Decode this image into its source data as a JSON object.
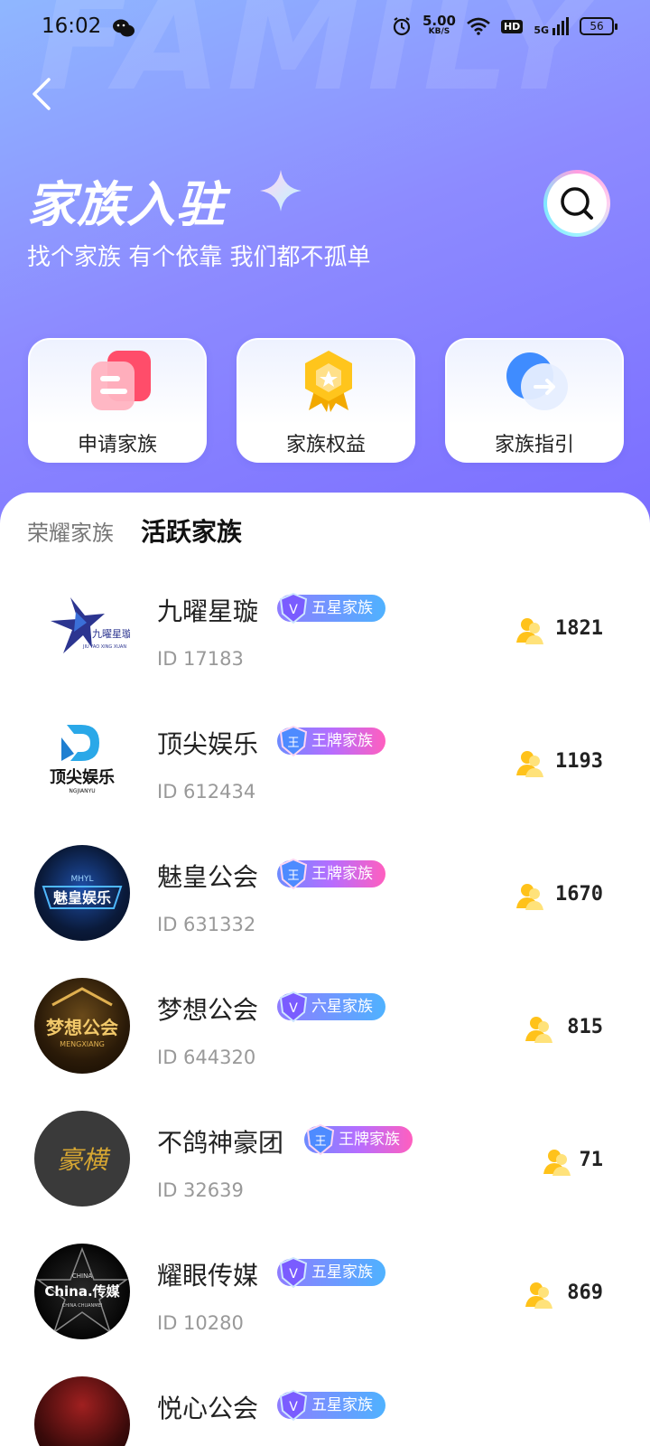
{
  "status_bar": {
    "time": "16:02",
    "net_speed": "5.00",
    "net_unit": "KB/S",
    "hd": "HD",
    "signal": "5G",
    "battery": "56"
  },
  "header": {
    "watermark": "FAMILY",
    "title": "家族入驻",
    "subtitle": "找个家族 有个依靠 我们都不孤单"
  },
  "cards": [
    {
      "label": "申请家族",
      "icon": "apply-document-icon"
    },
    {
      "label": "家族权益",
      "icon": "rights-medal-icon"
    },
    {
      "label": "家族指引",
      "icon": "guide-arrow-icon"
    }
  ],
  "tabs": [
    {
      "label": "荣耀家族",
      "active": false
    },
    {
      "label": "活跃家族",
      "active": true
    }
  ],
  "families": [
    {
      "name": "九曜星璇",
      "id": "ID 17183",
      "badge": "五星家族",
      "badge_type": "star",
      "members": "1821"
    },
    {
      "name": "顶尖娱乐",
      "id": "ID 612434",
      "badge": "王牌家族",
      "badge_type": "king",
      "members": "1193"
    },
    {
      "name": "魅皇公会",
      "id": "ID 631332",
      "badge": "王牌家族",
      "badge_type": "king",
      "members": "1670"
    },
    {
      "name": "梦想公会",
      "id": "ID 644320",
      "badge": "六星家族",
      "badge_type": "star",
      "members": "815"
    },
    {
      "name": "不鸽神豪团",
      "id": "ID 32639",
      "badge": "王牌家族",
      "badge_type": "king",
      "members": "71"
    },
    {
      "name": "耀眼传媒",
      "id": "ID 10280",
      "badge": "五星家族",
      "badge_type": "star",
      "members": "869"
    },
    {
      "name": "悦心公会",
      "id": "",
      "badge": "五星家族",
      "badge_type": "star",
      "members": ""
    }
  ],
  "logo_text": {
    "jiuyao_cn": "九曜星璇",
    "jiuyao_en": "JIU YAO XING XUAN",
    "dingjian_cn": "顶尖娱乐",
    "dingjian_en": "NGJIANYU",
    "meihuang_top": "MHYL",
    "meihuang_cn": "魅皇娱乐",
    "mengxiang_cn": "梦想公会",
    "mengxiang_en": "MENGXIANG",
    "haoxing": "豪横",
    "china_top": "CHINA",
    "china_main": "China.传媒",
    "china_bottom": "CHINA CHUANMEI"
  },
  "colors": {
    "hero_start": "#8fb7ff",
    "hero_end": "#7a6cff",
    "badge_star": "#4fb2ff",
    "badge_king": "#ff5fbf",
    "member_icon": "#ffc21a"
  }
}
